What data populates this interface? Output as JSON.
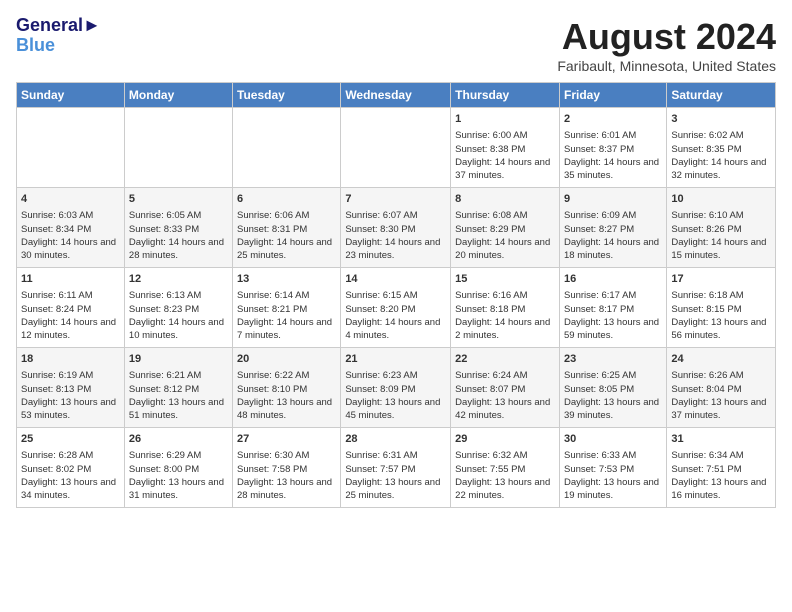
{
  "header": {
    "logo_line1": "General",
    "logo_line2": "Blue",
    "month_year": "August 2024",
    "location": "Faribault, Minnesota, United States"
  },
  "days_of_week": [
    "Sunday",
    "Monday",
    "Tuesday",
    "Wednesday",
    "Thursday",
    "Friday",
    "Saturday"
  ],
  "weeks": [
    [
      {
        "day": "",
        "info": ""
      },
      {
        "day": "",
        "info": ""
      },
      {
        "day": "",
        "info": ""
      },
      {
        "day": "",
        "info": ""
      },
      {
        "day": "1",
        "info": "Sunrise: 6:00 AM\nSunset: 8:38 PM\nDaylight: 14 hours and 37 minutes."
      },
      {
        "day": "2",
        "info": "Sunrise: 6:01 AM\nSunset: 8:37 PM\nDaylight: 14 hours and 35 minutes."
      },
      {
        "day": "3",
        "info": "Sunrise: 6:02 AM\nSunset: 8:35 PM\nDaylight: 14 hours and 32 minutes."
      }
    ],
    [
      {
        "day": "4",
        "info": "Sunrise: 6:03 AM\nSunset: 8:34 PM\nDaylight: 14 hours and 30 minutes."
      },
      {
        "day": "5",
        "info": "Sunrise: 6:05 AM\nSunset: 8:33 PM\nDaylight: 14 hours and 28 minutes."
      },
      {
        "day": "6",
        "info": "Sunrise: 6:06 AM\nSunset: 8:31 PM\nDaylight: 14 hours and 25 minutes."
      },
      {
        "day": "7",
        "info": "Sunrise: 6:07 AM\nSunset: 8:30 PM\nDaylight: 14 hours and 23 minutes."
      },
      {
        "day": "8",
        "info": "Sunrise: 6:08 AM\nSunset: 8:29 PM\nDaylight: 14 hours and 20 minutes."
      },
      {
        "day": "9",
        "info": "Sunrise: 6:09 AM\nSunset: 8:27 PM\nDaylight: 14 hours and 18 minutes."
      },
      {
        "day": "10",
        "info": "Sunrise: 6:10 AM\nSunset: 8:26 PM\nDaylight: 14 hours and 15 minutes."
      }
    ],
    [
      {
        "day": "11",
        "info": "Sunrise: 6:11 AM\nSunset: 8:24 PM\nDaylight: 14 hours and 12 minutes."
      },
      {
        "day": "12",
        "info": "Sunrise: 6:13 AM\nSunset: 8:23 PM\nDaylight: 14 hours and 10 minutes."
      },
      {
        "day": "13",
        "info": "Sunrise: 6:14 AM\nSunset: 8:21 PM\nDaylight: 14 hours and 7 minutes."
      },
      {
        "day": "14",
        "info": "Sunrise: 6:15 AM\nSunset: 8:20 PM\nDaylight: 14 hours and 4 minutes."
      },
      {
        "day": "15",
        "info": "Sunrise: 6:16 AM\nSunset: 8:18 PM\nDaylight: 14 hours and 2 minutes."
      },
      {
        "day": "16",
        "info": "Sunrise: 6:17 AM\nSunset: 8:17 PM\nDaylight: 13 hours and 59 minutes."
      },
      {
        "day": "17",
        "info": "Sunrise: 6:18 AM\nSunset: 8:15 PM\nDaylight: 13 hours and 56 minutes."
      }
    ],
    [
      {
        "day": "18",
        "info": "Sunrise: 6:19 AM\nSunset: 8:13 PM\nDaylight: 13 hours and 53 minutes."
      },
      {
        "day": "19",
        "info": "Sunrise: 6:21 AM\nSunset: 8:12 PM\nDaylight: 13 hours and 51 minutes."
      },
      {
        "day": "20",
        "info": "Sunrise: 6:22 AM\nSunset: 8:10 PM\nDaylight: 13 hours and 48 minutes."
      },
      {
        "day": "21",
        "info": "Sunrise: 6:23 AM\nSunset: 8:09 PM\nDaylight: 13 hours and 45 minutes."
      },
      {
        "day": "22",
        "info": "Sunrise: 6:24 AM\nSunset: 8:07 PM\nDaylight: 13 hours and 42 minutes."
      },
      {
        "day": "23",
        "info": "Sunrise: 6:25 AM\nSunset: 8:05 PM\nDaylight: 13 hours and 39 minutes."
      },
      {
        "day": "24",
        "info": "Sunrise: 6:26 AM\nSunset: 8:04 PM\nDaylight: 13 hours and 37 minutes."
      }
    ],
    [
      {
        "day": "25",
        "info": "Sunrise: 6:28 AM\nSunset: 8:02 PM\nDaylight: 13 hours and 34 minutes."
      },
      {
        "day": "26",
        "info": "Sunrise: 6:29 AM\nSunset: 8:00 PM\nDaylight: 13 hours and 31 minutes."
      },
      {
        "day": "27",
        "info": "Sunrise: 6:30 AM\nSunset: 7:58 PM\nDaylight: 13 hours and 28 minutes."
      },
      {
        "day": "28",
        "info": "Sunrise: 6:31 AM\nSunset: 7:57 PM\nDaylight: 13 hours and 25 minutes."
      },
      {
        "day": "29",
        "info": "Sunrise: 6:32 AM\nSunset: 7:55 PM\nDaylight: 13 hours and 22 minutes."
      },
      {
        "day": "30",
        "info": "Sunrise: 6:33 AM\nSunset: 7:53 PM\nDaylight: 13 hours and 19 minutes."
      },
      {
        "day": "31",
        "info": "Sunrise: 6:34 AM\nSunset: 7:51 PM\nDaylight: 13 hours and 16 minutes."
      }
    ]
  ]
}
